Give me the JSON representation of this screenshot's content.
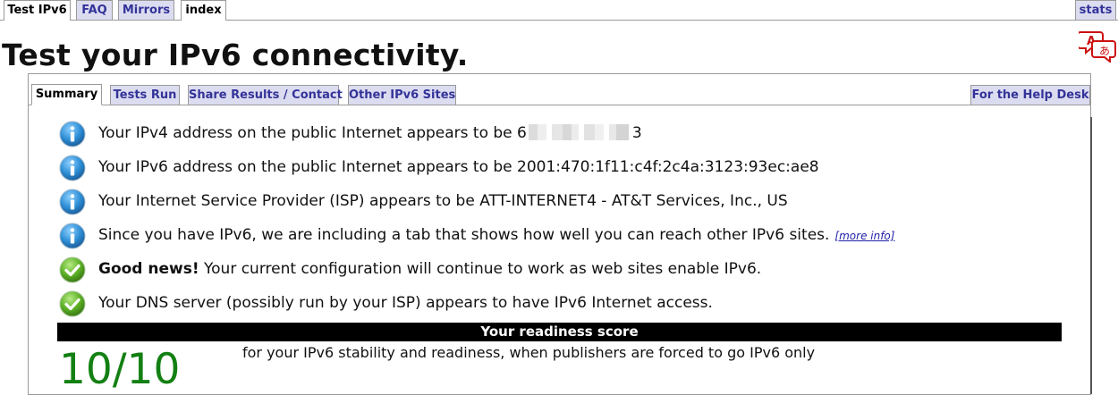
{
  "top_tabs": [
    {
      "label": "Test IPv6",
      "active": true
    },
    {
      "label": "FAQ",
      "active": false
    },
    {
      "label": "Mirrors",
      "active": false
    },
    {
      "label": "index",
      "active": true
    },
    {
      "label": "stats",
      "active": false
    }
  ],
  "page_title": "Test your IPv6 connectivity.",
  "sub_tabs": [
    {
      "label": "Summary",
      "active": true
    },
    {
      "label": "Tests Run",
      "active": false
    },
    {
      "label": "Share Results / Contact",
      "active": false
    },
    {
      "label": "Other IPv6 Sites",
      "active": false
    },
    {
      "label": "For the Help Desk",
      "active": false
    }
  ],
  "messages": {
    "ipv4": {
      "prefix": "Your IPv4 address on the public Internet appears to be 6",
      "suffix": "3",
      "icon": "info-icon"
    },
    "ipv6": {
      "text": "Your IPv6 address on the public Internet appears to be 2001:470:1f11:c4f:2c4a:3123:93ec:ae8",
      "icon": "info-icon"
    },
    "isp": {
      "text": "Your Internet Service Provider (ISP) appears to be ATT-INTERNET4 - AT&T Services, Inc., US",
      "icon": "info-icon"
    },
    "ipv6_tab": {
      "text": "Since you have IPv6, we are including a tab that shows how well you can reach other IPv6 sites.",
      "link": "[more info]",
      "icon": "info-icon"
    },
    "good_news": {
      "bold": "Good news!",
      "text": " Your current configuration will continue to work as web sites enable IPv6.",
      "icon": "check-icon"
    },
    "dns": {
      "text": "Your DNS server (possibly run by your ISP) appears to have IPv6 Internet access.",
      "icon": "check-icon"
    }
  },
  "readiness": {
    "heading": "Your readiness score",
    "score": "10/10",
    "description": "for your IPv6 stability and readiness, when publishers are forced to go IPv6 only",
    "score_color": "#138013"
  },
  "colors": {
    "tab_bg": "#dcdcf0",
    "tab_text": "#333399",
    "info_blue": "#2e8fd6",
    "check_green": "#5cb025",
    "translate_red": "#cc1111"
  }
}
